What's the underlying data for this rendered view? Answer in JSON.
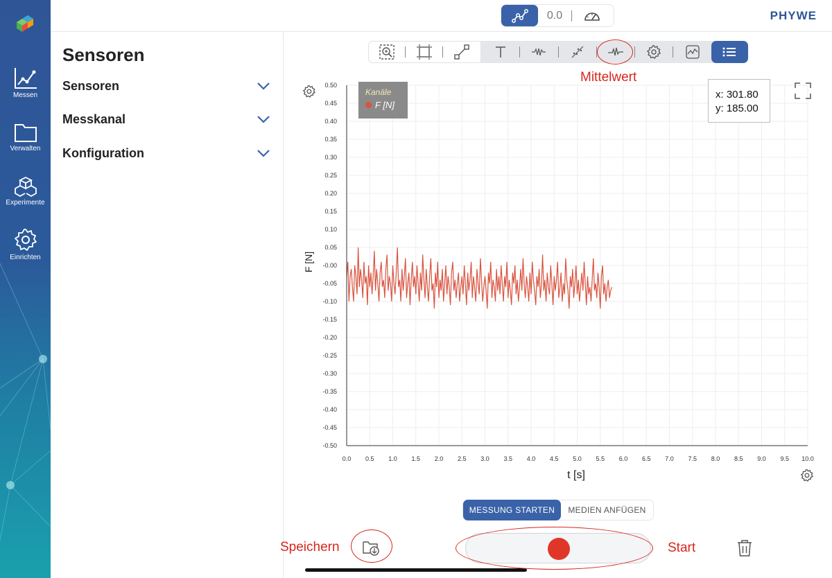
{
  "rail": {
    "items": [
      {
        "label": "Messen",
        "icon": "chart-line-icon"
      },
      {
        "label": "Verwalten",
        "icon": "folder-icon"
      },
      {
        "label": "Experimente",
        "icon": "cubes-icon"
      },
      {
        "label": "Einrichten",
        "icon": "gear-icon"
      }
    ]
  },
  "topbar": {
    "value_display": "0.0",
    "brand": "PHYWE"
  },
  "sidebar": {
    "title": "Sensoren",
    "sections": [
      {
        "label": "Sensoren"
      },
      {
        "label": "Messkanal"
      },
      {
        "label": "Konfiguration"
      }
    ]
  },
  "legend": {
    "header": "Kanäle",
    "series": "F [N]"
  },
  "readout": {
    "x": "x: 301.80",
    "y": "y: 185.00"
  },
  "annotations": {
    "mean": "Mittelwert",
    "save": "Speichern",
    "start": "Start"
  },
  "bottom": {
    "tab_start": "MESSUNG STARTEN",
    "tab_media": "MEDIEN ANFÜGEN"
  },
  "colors": {
    "accent": "#3a62a8",
    "series": "#d9533f",
    "record": "#e0362a",
    "annotation": "#d9251c"
  },
  "chart_data": {
    "type": "line",
    "xlabel": "t [s]",
    "ylabel": "F [N]",
    "xlim": [
      0,
      10
    ],
    "ylim": [
      -0.5,
      0.5
    ],
    "grid": true,
    "legend_position": "top-left",
    "x_ticks": [
      "0.0",
      "0.5",
      "1.0",
      "1.5",
      "2.0",
      "2.5",
      "3.0",
      "3.5",
      "4.0",
      "4.5",
      "5.0",
      "5.5",
      "6.0",
      "6.5",
      "7.0",
      "7.5",
      "8.0",
      "8.5",
      "9.0",
      "9.5",
      "10.0"
    ],
    "y_ticks": [
      "0.50",
      "0.45",
      "0.40",
      "0.35",
      "0.30",
      "0.25",
      "0.20",
      "0.15",
      "0.10",
      "0.05",
      "-0.00",
      "-0.05",
      "-0.10",
      "-0.15",
      "-0.20",
      "-0.25",
      "-0.30",
      "-0.35",
      "-0.40",
      "-0.45",
      "-0.50"
    ],
    "series": [
      {
        "name": "F [N]",
        "x_start": 0,
        "x_step": 0.025,
        "values": [
          -0.03,
          0.01,
          -0.1,
          -0.03,
          -0.01,
          -0.06,
          -0.1,
          0.0,
          -0.03,
          -0.08,
          0.05,
          -0.06,
          -0.01,
          -0.04,
          -0.09,
          0.01,
          -0.05,
          -0.03,
          -0.11,
          0.0,
          -0.06,
          -0.02,
          -0.08,
          -0.03,
          0.04,
          -0.07,
          -0.01,
          -0.05,
          -0.1,
          -0.02,
          0.01,
          -0.06,
          -0.04,
          -0.09,
          -0.01,
          0.03,
          -0.07,
          -0.03,
          -0.05,
          -0.1,
          0.0,
          -0.05,
          -0.08,
          -0.02,
          0.05,
          -0.06,
          -0.04,
          -0.1,
          -0.01,
          -0.07,
          -0.03,
          0.02,
          -0.09,
          -0.05,
          -0.02,
          -0.11,
          -0.04,
          0.01,
          -0.06,
          -0.03,
          -0.08,
          0.0,
          -0.05,
          -0.1,
          -0.02,
          -0.07,
          0.03,
          -0.04,
          -0.09,
          -0.01,
          -0.06,
          -0.1,
          -0.03,
          0.02,
          -0.07,
          -0.05,
          -0.12,
          -0.02,
          -0.06,
          0.01,
          -0.09,
          -0.04,
          -0.07,
          -0.01,
          -0.1,
          -0.05,
          0.0,
          -0.08,
          -0.03,
          -0.06,
          -0.11,
          -0.02,
          0.01,
          -0.07,
          -0.04,
          -0.09,
          -0.05,
          -0.02,
          -0.1,
          -0.06,
          -0.03,
          -0.08,
          0.0,
          -0.05,
          -0.11,
          -0.02,
          -0.07,
          -0.04,
          0.01,
          -0.09,
          -0.03,
          -0.06,
          -0.1,
          -0.01,
          -0.05,
          -0.08,
          0.02,
          -0.04,
          -0.1,
          -0.06,
          -0.03,
          -0.07,
          -0.12,
          -0.02,
          -0.05,
          0.01,
          -0.09,
          -0.04,
          -0.06,
          -0.1,
          -0.01,
          -0.07,
          -0.03,
          -0.08,
          0.0,
          -0.05,
          -0.1,
          -0.03,
          -0.06,
          0.01,
          -0.09,
          -0.04,
          -0.07,
          -0.11,
          -0.02,
          -0.05,
          0.0,
          -0.08,
          -0.04,
          -0.1,
          -0.06,
          -0.01,
          -0.07,
          0.02,
          -0.05,
          -0.09,
          -0.03,
          -0.06,
          -0.1,
          -0.02,
          -0.08,
          0.01,
          -0.04,
          -0.07,
          -0.11,
          -0.03,
          -0.06,
          -0.01,
          -0.09,
          -0.05,
          0.03,
          -0.07,
          -0.04,
          -0.1,
          -0.02,
          -0.06,
          -0.08,
          0.0,
          -0.05,
          -0.11,
          -0.03,
          -0.07,
          -0.04,
          0.01,
          -0.09,
          -0.06,
          -0.02,
          -0.1,
          -0.05,
          -0.08,
          0.02,
          -0.04,
          -0.07,
          -0.12,
          -0.03,
          -0.06,
          -0.01,
          -0.09,
          -0.05,
          0.0,
          -0.08,
          -0.04,
          -0.1,
          -0.06,
          -0.02,
          -0.07,
          0.01,
          -0.05,
          -0.11,
          -0.03,
          -0.08,
          -0.06,
          -0.1,
          -0.04,
          0.02,
          -0.07,
          -0.05,
          -0.09,
          -0.02,
          -0.06,
          -0.12,
          -0.03,
          0.0,
          -0.08,
          -0.05,
          -0.1,
          -0.06,
          -0.04,
          -0.09,
          -0.07,
          -0.06
        ]
      }
    ]
  }
}
